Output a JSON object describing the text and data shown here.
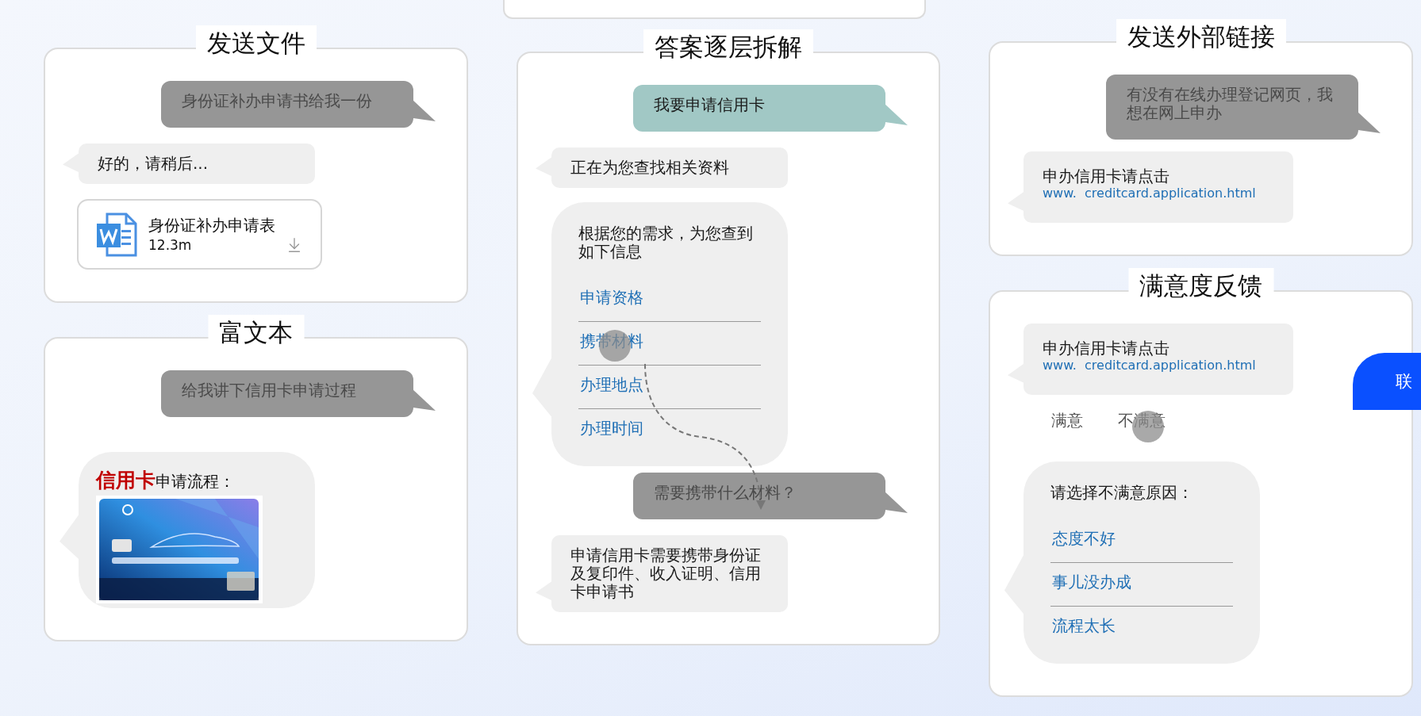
{
  "columns": [
    {
      "sections": [
        {
          "title": "发送文件",
          "messages": [
            {
              "kind": "user",
              "text": "身份证补办申请书给我一份",
              "color": "#969696"
            },
            {
              "kind": "bot",
              "text": "好的，请稍后..."
            },
            {
              "kind": "file",
              "name": "身份证补办申请表",
              "size": "12.3m"
            }
          ]
        },
        {
          "title": "富文本",
          "messages": [
            {
              "kind": "user",
              "text": "给我讲下信用卡申请过程",
              "color": "#969696"
            },
            {
              "kind": "rich",
              "text": "**信用卡**申请流程："
            }
          ]
        }
      ]
    },
    {
      "sections": [
        {
          "title": "答案逐层拆解",
          "messages": [
            {
              "kind": "user",
              "text": "我要申请信用卡",
              "color": "#a1c8c5"
            },
            {
              "kind": "bot",
              "text": "正在为您查找相关资料"
            },
            {
              "kind": "menu",
              "text": "根据您的需求，为您查到如下信息",
              "items": [
                {
                  "label": "申请资格",
                  "selected": false
                },
                {
                  "label": "携带材料",
                  "selected": true
                },
                {
                  "label": "办理地点",
                  "selected": false
                },
                {
                  "label": "办理时间",
                  "selected": false
                }
              ]
            },
            {
              "kind": "user",
              "text": "需要携带什么材料？",
              "color": "#969696"
            },
            {
              "kind": "bot",
              "text": "申请信用卡需要携带身份证及复印件、收入证明、信用卡申请书"
            }
          ]
        }
      ]
    },
    {
      "sections": [
        {
          "title": "发送外部链接",
          "messages": [
            {
              "kind": "user",
              "text": "有没有在线办理登记网页，我想在网上申办",
              "color": "#969696"
            },
            {
              "kind": "link",
              "text": "申办信用卡请点击",
              "url": "www.  creditcard.application.html"
            }
          ]
        },
        {
          "title": "满意度反馈",
          "messages": [
            {
              "kind": "link",
              "text": "申办信用卡请点击",
              "url": "www.  creditcard.application.html"
            },
            {
              "kind": "choices",
              "options": [
                {
                  "label": "满意",
                  "selected": false
                },
                {
                  "label": "不满意",
                  "selected": true
                }
              ]
            },
            {
              "kind": "menu",
              "text": "请选择不满意原因：",
              "items": [
                {
                  "label": "态度不好",
                  "selected": false
                },
                {
                  "label": "事儿没办成",
                  "selected": false
                },
                {
                  "label": "流程太长",
                  "selected": false
                }
              ]
            }
          ]
        }
      ]
    }
  ],
  "side_button": {
    "label": "联"
  }
}
